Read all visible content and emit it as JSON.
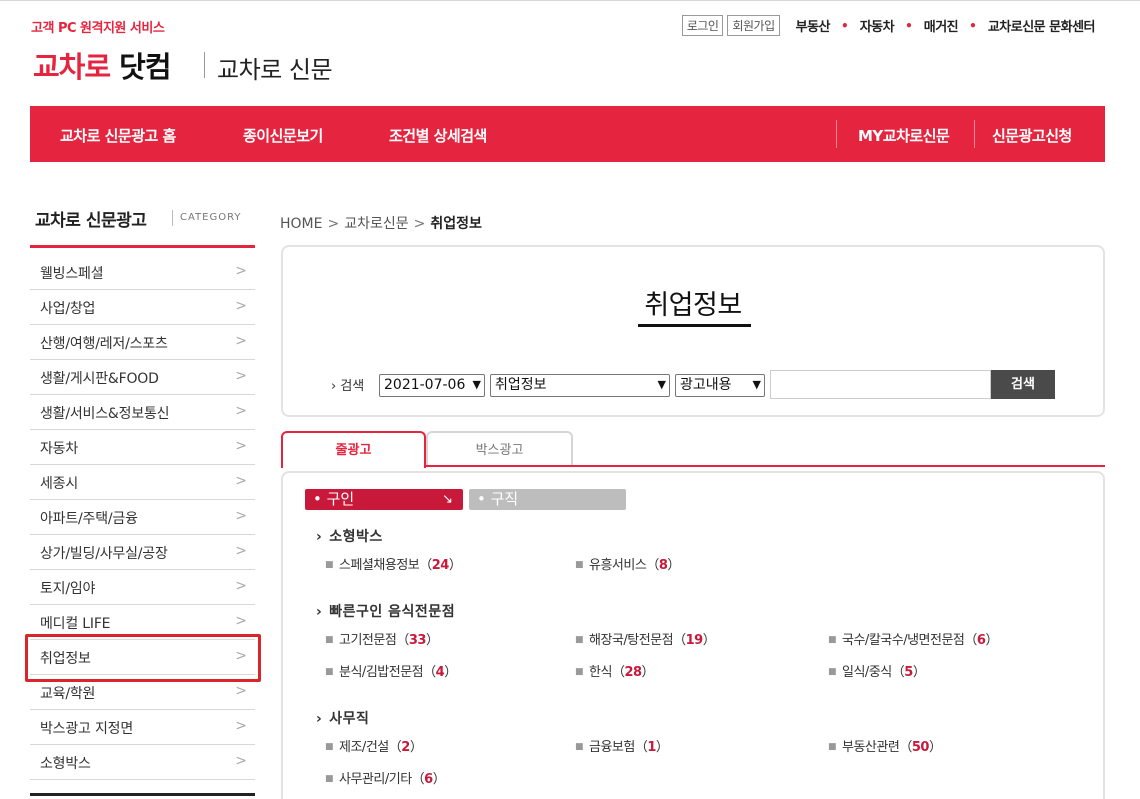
{
  "header": {
    "service_label": "고객 PC 원격지원 서비스",
    "logo_red": "교차로",
    "logo_black": "닷컴",
    "logo_sub": "교차로 신문",
    "login": "로그인",
    "signup": "회원가입",
    "links": [
      "부동산",
      "자동차",
      "매거진",
      "교차로신문 문화센터"
    ]
  },
  "gnb": {
    "left": [
      "교차로 신문광고 홈",
      "종이신문보기",
      "조건별 상세검색"
    ],
    "right": [
      "MY교차로신문",
      "신문광고신청"
    ]
  },
  "sidebar": {
    "title": "교차로 신문광고",
    "category": "CATEGORY",
    "items": [
      {
        "label": "웰빙스페셜"
      },
      {
        "label": "사업/창업"
      },
      {
        "label": "산행/여행/레저/스포츠"
      },
      {
        "label": "생활/게시판&FOOD"
      },
      {
        "label": "생활/서비스&정보통신"
      },
      {
        "label": "자동차"
      },
      {
        "label": "세종시"
      },
      {
        "label": "아파트/주택/금융"
      },
      {
        "label": "상가/빌딩/사무실/공장"
      },
      {
        "label": "토지/임야"
      },
      {
        "label": "메디컬 LIFE"
      },
      {
        "label": "취업정보"
      },
      {
        "label": "교육/학원"
      },
      {
        "label": "박스광고 지정면"
      },
      {
        "label": "소형박스"
      }
    ],
    "highlighted": "취업정보"
  },
  "breadcrumb": {
    "home": "HOME",
    "mid": "교차로신문",
    "current": "취업정보"
  },
  "search": {
    "page_title": "취업정보",
    "label": "검색",
    "date": "2021-07-06",
    "category": "취업정보",
    "field": "광고내용",
    "query": "",
    "button": "검색"
  },
  "tabs": [
    "줄광고",
    "박스광고"
  ],
  "pills": {
    "active": "구인",
    "inactive": "구직"
  },
  "sections": [
    {
      "title": "소형박스",
      "items": [
        {
          "name": "스페셜채용정보",
          "count": "24"
        },
        {
          "name": "유흥서비스",
          "count": "8"
        }
      ]
    },
    {
      "title": "빠른구인 음식전문점",
      "items": [
        {
          "name": "고기전문점",
          "count": "33"
        },
        {
          "name": "해장국/탕전문점",
          "count": "19"
        },
        {
          "name": "국수/칼국수/냉면전문점",
          "count": "6"
        },
        {
          "name": "분식/김밥전문점",
          "count": "4"
        },
        {
          "name": "한식",
          "count": "28"
        },
        {
          "name": "일식/중식",
          "count": "5"
        }
      ]
    },
    {
      "title": "사무직",
      "items": [
        {
          "name": "제조/건설",
          "count": "2"
        },
        {
          "name": "금융보험",
          "count": "1"
        },
        {
          "name": "부동산관련",
          "count": "50"
        },
        {
          "name": "사무관리/기타",
          "count": "6"
        }
      ]
    }
  ],
  "colors": {
    "brand_red": "#e5253f",
    "pill_red": "#c8193a",
    "highlight": "#d9262b"
  }
}
